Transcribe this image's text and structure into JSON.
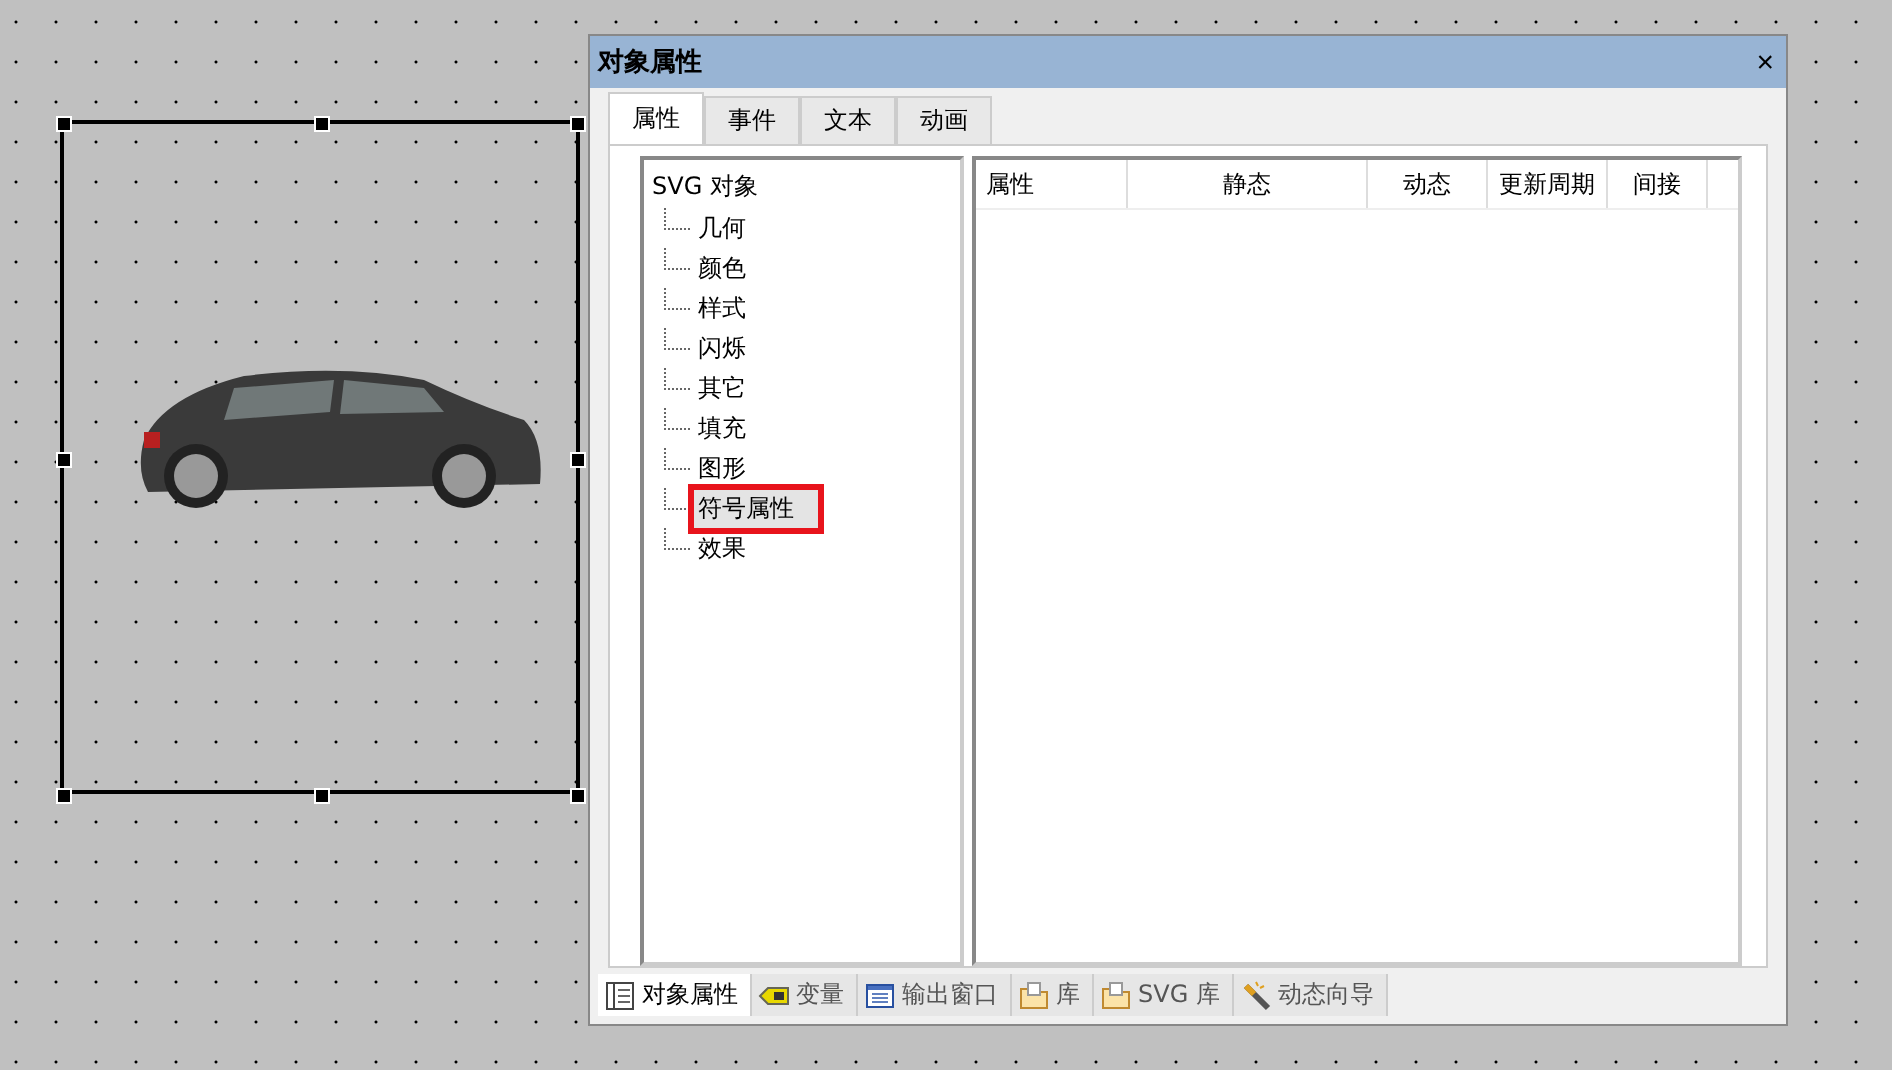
{
  "canvas": {
    "object": {
      "selected": true
    }
  },
  "panel": {
    "title": "对象属性",
    "close": "×",
    "tabs": [
      {
        "label": "属性",
        "selected": true
      },
      {
        "label": "事件",
        "selected": false
      },
      {
        "label": "文本",
        "selected": false
      },
      {
        "label": "动画",
        "selected": false
      }
    ],
    "tree": {
      "label": "SVG 对象",
      "children": [
        {
          "label": "几何",
          "selected": false,
          "highlighted": false
        },
        {
          "label": "颜色",
          "selected": false,
          "highlighted": false
        },
        {
          "label": "样式",
          "selected": false,
          "highlighted": false
        },
        {
          "label": "闪烁",
          "selected": false,
          "highlighted": false
        },
        {
          "label": "其它",
          "selected": false,
          "highlighted": false
        },
        {
          "label": "填充",
          "selected": false,
          "highlighted": false
        },
        {
          "label": "图形",
          "selected": false,
          "highlighted": false
        },
        {
          "label": "符号属性",
          "selected": true,
          "highlighted": true
        },
        {
          "label": "效果",
          "selected": false,
          "highlighted": false
        }
      ]
    },
    "table": {
      "columns": [
        "属性",
        "静态",
        "动态",
        "更新周期",
        "间接"
      ]
    },
    "bottom_tabs": [
      {
        "label": "对象属性",
        "kind": "properties",
        "selected": true
      },
      {
        "label": "变量",
        "kind": "tag",
        "selected": false
      },
      {
        "label": "输出窗口",
        "kind": "output",
        "selected": false
      },
      {
        "label": "库",
        "kind": "folder",
        "selected": false
      },
      {
        "label": "SVG 库",
        "kind": "folder",
        "selected": false
      },
      {
        "label": "动态向导",
        "kind": "wand",
        "selected": false
      }
    ]
  }
}
